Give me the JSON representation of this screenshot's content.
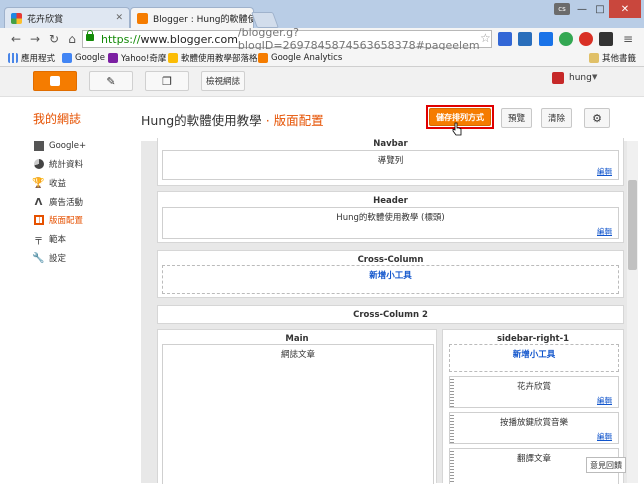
{
  "browser": {
    "tabs": [
      {
        "title": "花卉欣賞",
        "active": false
      },
      {
        "title": "Blogger : Hung的軟體使",
        "active": true
      }
    ],
    "window_badge": "cs",
    "url": {
      "scheme": "https://",
      "host": "www.blogger.com",
      "path": "/blogger.g?blogID=2697845874563658378#pageelem"
    },
    "bookmarks": [
      "應用程式",
      "Google",
      "Yahoo!奇摩",
      "軟體使用教學部落格",
      "Google Analytics"
    ],
    "other_bookmarks": "其他書籤"
  },
  "blogger_header": {
    "view_blog": "檢視網誌",
    "user": "hung"
  },
  "subheader": {
    "my_blogs": "我的網誌",
    "blog_title": "Hung的軟體使用教學",
    "separator": "·",
    "page": "版面配置",
    "save_arrangement": "儲存排列方式",
    "preview": "預覽",
    "clear": "清除"
  },
  "sidebar": {
    "items": [
      {
        "label": "Google+",
        "icon": "google-plus-icon"
      },
      {
        "label": "統計資料",
        "icon": "stats-icon"
      },
      {
        "label": "收益",
        "icon": "trophy-icon"
      },
      {
        "label": "廣告活動",
        "icon": "adwords-icon"
      },
      {
        "label": "版面配置",
        "icon": "layout-icon",
        "active": true
      },
      {
        "label": "範本",
        "icon": "template-icon"
      },
      {
        "label": "設定",
        "icon": "wrench-icon"
      }
    ]
  },
  "layout": {
    "navbar": {
      "title": "Navbar",
      "gadget": "導覽列",
      "edit": "編輯"
    },
    "header": {
      "title": "Header",
      "gadget": "Hung的軟體使用教學 (標頭)",
      "edit": "編輯"
    },
    "cross_column": {
      "title": "Cross-Column",
      "add": "新增小工具"
    },
    "cross_column_2": {
      "title": "Cross-Column 2"
    },
    "main": {
      "title": "Main",
      "gadget": "網誌文章"
    },
    "sidebar_right": {
      "title": "sidebar-right-1",
      "add": "新增小工具",
      "gadgets": [
        {
          "name": "花卉欣賞",
          "edit": "編輯"
        },
        {
          "name": "按播放鍵欣賞音樂",
          "edit": "編輯"
        },
        {
          "name": "翻譯文章",
          "edit": ""
        }
      ]
    },
    "feedback": "意見回饋"
  }
}
